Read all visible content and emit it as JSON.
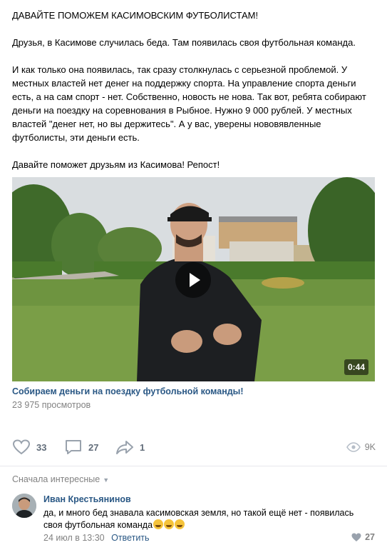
{
  "post": {
    "title": "ДАВАЙТЕ ПОМОЖЕМ КАСИМОВСКИМ ФУТБОЛИСТАМ!",
    "paragraph1": "Друзья, в Касимове случилась беда. Там появилась своя футбольная команда.",
    "paragraph2": "И как только она появилась, так сразу столкнулась с серьезной проблемой. У местных властей нет денег на поддержку спорта. На управление спорта деньги есть, а на сам спорт - нет. Собственно, новость не нова. Так вот, ребята собирают деньги на поездку на соревнования в Рыбное. Нужно 9 000 рублей. У местных властей \"денег нет, но вы держитесь\". А у вас, уверены нововявленные футболисты, эти деньги есть.",
    "paragraph3": "Давайте поможет друзьям из Касимова! Репост!"
  },
  "video": {
    "duration": "0:44",
    "title": "Собираем деньги на поездку футбольной команды!",
    "views": "23 975 просмотров",
    "play_icon": "play-icon"
  },
  "actions": {
    "likes": "33",
    "comments": "27",
    "shares": "1",
    "views": "9K"
  },
  "comments": {
    "sort_label": "Сначала интересные",
    "items": [
      {
        "author": "Иван Крестьянинов",
        "text": "да, и много бед знавала касимовская земля, но такой ещё нет - появилась своя футбольная команда",
        "emoji": [
          "rofl-emoji",
          "rofl-emoji",
          "rofl-emoji"
        ],
        "date": "24 июл в 13:30",
        "reply_label": "Ответить",
        "likes": "27"
      }
    ]
  },
  "colors": {
    "link": "#2a5885",
    "muted": "#828282",
    "icon": "#99a2ad"
  }
}
